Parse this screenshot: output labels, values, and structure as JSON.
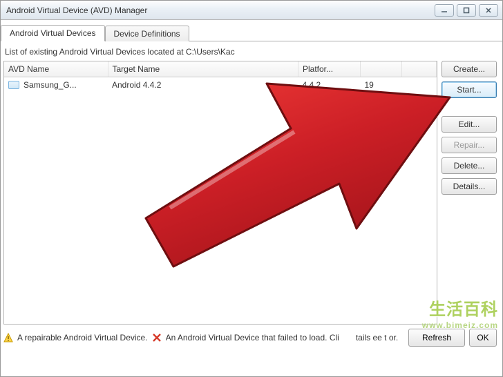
{
  "window": {
    "title": "Android Virtual Device (AVD) Manager"
  },
  "tabs": {
    "avd": "Android Virtual Devices",
    "defs": "Device Definitions"
  },
  "intro": "List of existing Android Virtual Devices located at C:\\Users\\Kac",
  "columns": {
    "c0": "AVD Name",
    "c1": "Target Name",
    "c2": "Platfor...",
    "c3": "",
    "c4": ""
  },
  "row": {
    "name": "Samsung_G...",
    "target": "Android 4.4.2",
    "platform": "4.4.2",
    "api": "19"
  },
  "buttons": {
    "create": "Create...",
    "start": "Start...",
    "edit": "Edit...",
    "repair": "Repair...",
    "delete": "Delete...",
    "details": "Details...",
    "refresh": "Refresh",
    "ok": "OK"
  },
  "footer": {
    "repairable": "A repairable Android Virtual Device.",
    "failed": "An Android Virtual Device that failed to load. Cli",
    "suffix": "tails   ee t   or."
  },
  "watermark": {
    "cn": "生活百科",
    "url": "www.bimeiz.com"
  }
}
